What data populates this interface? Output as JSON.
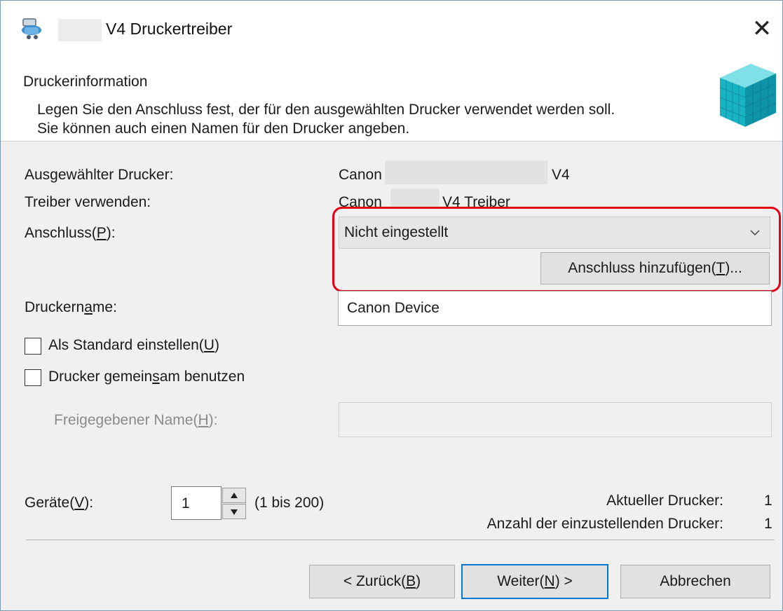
{
  "window": {
    "title": "V4 Druckertreiber",
    "close_label": "✕"
  },
  "header": {
    "title": "Druckerinformation",
    "description_line1": "Legen Sie den Anschluss fest, der für den ausgewählten Drucker verwendet werden soll.",
    "description_line2": "Sie können auch einen Namen für den Drucker angeben."
  },
  "info": {
    "selected_printer_label": "Ausgewählter Drucker:",
    "selected_printer_prefix": "Canon",
    "selected_printer_suffix": "V4",
    "driver_label": "Treiber verwenden:",
    "driver_prefix": "Canon",
    "driver_suffix": "V4 Treiber"
  },
  "port": {
    "label_pre": "Anschluss(",
    "label_key": "P",
    "label_post": "):",
    "selected": "Nicht eingestellt",
    "add_pre": "Anschluss hinzufügen(",
    "add_key": "T",
    "add_post": ")..."
  },
  "printer_name": {
    "label_pre": "Druckern",
    "label_key": "a",
    "label_post": "me:",
    "value": "Canon Device"
  },
  "options": {
    "default_pre": "Als Standard einstellen(",
    "default_key": "U",
    "default_post": ")",
    "share_pre": "Drucker gemein",
    "share_key": "s",
    "share_post": "am benutzen",
    "shared_name_pre": "Freigegebener Name(",
    "shared_name_key": "H",
    "shared_name_post": "):"
  },
  "devices": {
    "label_pre": "Geräte(",
    "label_key": "V",
    "label_post": "):",
    "value": "1",
    "range": "(1 bis 200)",
    "current_label": "Aktueller Drucker:",
    "current_value": "1",
    "count_label": "Anzahl der einzustellenden Drucker:",
    "count_value": "1"
  },
  "buttons": {
    "back_pre": "< Zurück(",
    "back_key": "B",
    "back_post": ")",
    "next_pre": "Weiter(",
    "next_key": "N",
    "next_post": ") >",
    "cancel": "Abbrechen"
  },
  "colors": {
    "highlight": "#e60012",
    "accent": "#0078d7",
    "cube": "#1cb8c8"
  },
  "icons": {
    "title": "printer-setup-icon",
    "header": "cube-stack-icon",
    "dropdown": "chevron-down-icon"
  }
}
